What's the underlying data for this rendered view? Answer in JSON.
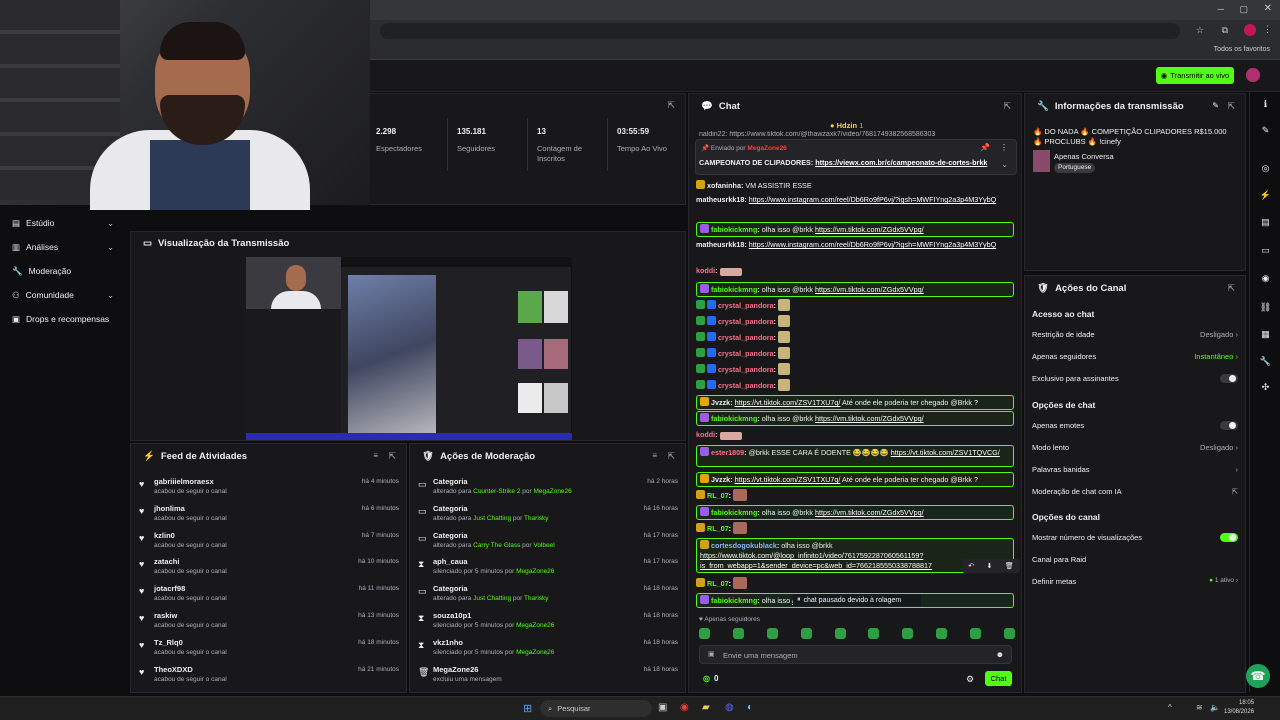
{
  "browser": {
    "bookmarks_label": "Todos os favoritos"
  },
  "topbar": {
    "go_live": "Transmitir ao vivo"
  },
  "sidebar": {
    "items": [
      {
        "label": "Estúdio",
        "icon": "studio-icon",
        "chev": "⌄"
      },
      {
        "label": "Análises",
        "icon": "chart-icon",
        "chev": "⌄"
      },
      {
        "label": "Moderação",
        "icon": "wrench-icon",
        "chev": ""
      },
      {
        "label": "Comunidade",
        "icon": "people-icon",
        "chev": "⌄"
      },
      {
        "label": "Drops e recompensas",
        "icon": "gift-icon",
        "chev": ""
      }
    ]
  },
  "stats": [
    {
      "value": "2.298",
      "label": "Espectadores"
    },
    {
      "value": "135.181",
      "label": "Seguidores"
    },
    {
      "value": "13",
      "label": "Contagem de Inscritos"
    },
    {
      "value": "03:55:59",
      "label": "Tempo Ao Vivo"
    }
  ],
  "preview": {
    "title": "Visualização da Transmissão"
  },
  "feed": {
    "title": "Feed de Atividades",
    "items": [
      {
        "name": "gabriiielmoraesx",
        "sub": "acabou de seguir o canal",
        "time": "há 4 minutos"
      },
      {
        "name": "jhonlima",
        "sub": "acabou de seguir o canal",
        "time": "há 6 minutos"
      },
      {
        "name": "kzlin0",
        "sub": "acabou de seguir o canal",
        "time": "há 7 minutos"
      },
      {
        "name": "zatachi",
        "sub": "acabou de seguir o canal",
        "time": "há 10 minutos"
      },
      {
        "name": "jotacrf98",
        "sub": "acabou de seguir o canal",
        "time": "há 11 minutos"
      },
      {
        "name": "raskiw",
        "sub": "acabou de seguir o canal",
        "time": "há 13 minutos"
      },
      {
        "name": "Tz_Rlq0",
        "sub": "acabou de seguir o canal",
        "time": "há 18 minutos"
      },
      {
        "name": "TheoXDXD",
        "sub": "acabou de seguir o canal",
        "time": "há 21 minutos"
      }
    ]
  },
  "modactions": {
    "title": "Ações de Moderação",
    "items": [
      {
        "icon": "category-icon",
        "name": "Categoria",
        "pre": "alterado para ",
        "g1": "Counter-Strike 2",
        "mid": " por ",
        "g2": "MegaZone26",
        "time": "há 2 horas"
      },
      {
        "icon": "category-icon",
        "name": "Categoria",
        "pre": "alterado para ",
        "g1": "Just Chatting",
        "mid": " por ",
        "g2": "Tharisky",
        "time": "há 16 horas"
      },
      {
        "icon": "category-icon",
        "name": "Categoria",
        "pre": "alterado para ",
        "g1": "Carry The Glass",
        "mid": " por ",
        "g2": "Volbeel",
        "time": "há 17 horas"
      },
      {
        "icon": "hourglass-icon",
        "name": "aph_caua",
        "pre": "silenciado por 5 minutos por ",
        "g1": "MegaZone26",
        "mid": "",
        "g2": "",
        "time": "há 17 horas"
      },
      {
        "icon": "category-icon",
        "name": "Categoria",
        "pre": "alterado para ",
        "g1": "Just Chatting",
        "mid": " por ",
        "g2": "Tharisky",
        "time": "há 18 horas"
      },
      {
        "icon": "hourglass-icon",
        "name": "souza10p1",
        "pre": "silenciado por 5 minutos por ",
        "g1": "MegaZone26",
        "mid": "",
        "g2": "",
        "time": "há 18 horas"
      },
      {
        "icon": "hourglass-icon",
        "name": "vkz1nho",
        "pre": "silenciado por 5 minutos por ",
        "g1": "MegaZone26",
        "mid": "",
        "g2": "",
        "time": "há 18 horas"
      },
      {
        "icon": "trash-icon",
        "name": "MegaZone26",
        "pre": "excluiu uma mensagem",
        "g1": "",
        "mid": "",
        "g2": "",
        "time": "há 18 horas"
      }
    ]
  },
  "chat": {
    "title": "Chat",
    "gift_user": "Hdzin",
    "gift_count": "1",
    "pinned_by": "Enviado por",
    "pinned_user": "MegaZone26",
    "pinned_text": "CAMPEONATO DE CLIPADORES: ",
    "pinned_link": "https://viewx.com.br/c/campeonato-de-cortes-brkk",
    "top_cut": "naldin22: https://www.tiktok.com/@thawzaxk7/video/7681749382568586303",
    "messages": [
      {
        "user": "xofaninha",
        "color": "#efeff1",
        "text": "VM ASSISTIR ESSE",
        "link": "",
        "hl": false
      },
      {
        "user": "matheusrkk18",
        "color": "#efeff1",
        "text": "",
        "link": "https://www.instagram.com/reel/Db6Ro9fP6vj/?igsh=MWFIYng2a3p4M3YybQ",
        "hl": false
      },
      {
        "user": "fabiokickmng",
        "color": "#53fc18",
        "text": "olha isso @brkk ",
        "link": "https://vm.tiktok.com/ZGdx5VVpq/",
        "hl": true
      },
      {
        "user": "matheusrkk18",
        "color": "#efeff1",
        "text": "",
        "link": "https://www.instagram.com/reel/Db6Ro9fP6vj/?igsh=MWFIYng2a3p4M3YybQ",
        "hl": false
      },
      {
        "user": "koddi",
        "color": "#ff6b8a",
        "text": "",
        "link": "",
        "hl": false
      },
      {
        "user": "fabiokickmng",
        "color": "#53fc18",
        "text": "olha isso @brkk ",
        "link": "https://vm.tiktok.com/ZGdx5VVpq/",
        "hl": true
      },
      {
        "user": "crystal_pandora",
        "color": "#ff6b8a",
        "text": "",
        "link": "",
        "hl": false
      },
      {
        "user": "crystal_pandora",
        "color": "#ff6b8a",
        "text": "",
        "link": "",
        "hl": false
      },
      {
        "user": "crystal_pandora",
        "color": "#ff6b8a",
        "text": "",
        "link": "",
        "hl": false
      },
      {
        "user": "crystal_pandora",
        "color": "#ff6b8a",
        "text": "",
        "link": "",
        "hl": false
      },
      {
        "user": "crystal_pandora",
        "color": "#ff6b8a",
        "text": "",
        "link": "",
        "hl": false
      },
      {
        "user": "crystal_pandora",
        "color": "#ff6b8a",
        "text": "",
        "link": "",
        "hl": false
      },
      {
        "user": "Jvzzk",
        "color": "#efeff1",
        "text": " Até onde ele poderia ter chegado @Brkk ?",
        "link": "https://vt.tiktok.com/ZSV1TXU7q/",
        "hl": true
      },
      {
        "user": "fabiokickmng",
        "color": "#53fc18",
        "text": "olha isso @brkk ",
        "link": "https://vm.tiktok.com/ZGdx5VVpq/",
        "hl": true
      },
      {
        "user": "koddi",
        "color": "#ff6b8a",
        "text": "",
        "link": "",
        "hl": false
      },
      {
        "user": "ester1809",
        "color": "#ff6b8a",
        "text": "@brkk ESSE CARA É DOENTE 😂😂😂😂 ",
        "link": "https://vt.tiktok.com/ZSV1TQVCG/",
        "hl": true
      },
      {
        "user": "Jvzzk",
        "color": "#efeff1",
        "text": " Até onde ele poderia ter chegado @Brkk ?",
        "link": "https://vt.tiktok.com/ZSV1TXU7q/",
        "hl": true
      },
      {
        "user": "RL_07",
        "color": "#53fc18",
        "text": "",
        "link": "",
        "hl": false
      },
      {
        "user": "fabiokickmng",
        "color": "#53fc18",
        "text": "olha isso @brkk ",
        "link": "https://vm.tiktok.com/ZGdx5VVpq/",
        "hl": true
      },
      {
        "user": "RL_07",
        "color": "#53fc18",
        "text": "",
        "link": "",
        "hl": false
      },
      {
        "user": "cortesdogokublack",
        "color": "#8ab4f8",
        "text": "olha isso @brkk ",
        "link": "https://www.tiktok.com/@loop_infinito1/video/7617592287060561159?is_from_webapp=1&sender_device=pc&web_id=7662185550338788817",
        "hl": true
      },
      {
        "user": "RL_07",
        "color": "#53fc18",
        "text": "",
        "link": "",
        "hl": false
      },
      {
        "user": "fabiokickmng",
        "color": "#53fc18",
        "text": "olha isso ",
        "link": "/pq/",
        "hl": true
      }
    ],
    "paused": "chat pausado devido à rolagem",
    "followers_only": "Apenas seguidores",
    "input_placeholder": "Envie uma mensagem",
    "count": "0",
    "send": "Chat"
  },
  "info": {
    "title": "Informações da transmissão",
    "stream_title": "🔥 DO NADA 🔥 COMPETIÇÃO CLIPADORES R$15.000 🔥 PROCLUBS 🔥 !cinefy",
    "category": "Apenas Conversa",
    "language": "Portuguese"
  },
  "channel": {
    "title": "Ações do Canal",
    "chat_access": "Acesso ao chat",
    "age": "Restrição de idade",
    "age_val": "Desligado",
    "followers": "Apenas seguidores",
    "followers_val": "Instantâneo",
    "subs": "Exclusivo para assinantes",
    "chat_opts": "Opções de chat",
    "emotes": "Apenas emotes",
    "slow": "Modo lento",
    "slow_val": "Desligado",
    "banned": "Palavras banidas",
    "ai_mod": "Moderação de chat com IA",
    "chan_opts": "Opções do canal",
    "views": "Mostrar número de visualizações",
    "raid": "Canal para Raid",
    "goals": "Definir metas",
    "goals_val": "1 ativo"
  },
  "taskbar": {
    "search": "Pesquisar",
    "time": "18:05",
    "date": "13/08/2026"
  }
}
